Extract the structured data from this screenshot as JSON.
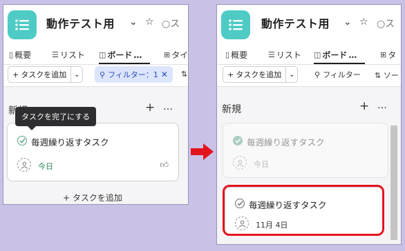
{
  "project": {
    "title": "動作テスト用",
    "star_icon": "star-icon",
    "status_fragment_left": "○ス",
    "status_fragment_right": "○ス"
  },
  "tabs": {
    "overview": "概要",
    "list": "リスト",
    "board": "ボード",
    "more": "…",
    "fragment_left": "タイ",
    "fragment_right": "タ"
  },
  "toolbar": {
    "add_task": "タスクを追加",
    "filter_active": "フィルター：1",
    "filter": "フィルター",
    "sort_right": "ソート"
  },
  "column": {
    "title": "新規",
    "plus": "+",
    "more": "…",
    "add_task_footer": "タスクを追加"
  },
  "left_card": {
    "tooltip": "タスクを完了にする",
    "name": "毎週繰り返すタスク",
    "due": "今日",
    "due_color": "#2e8a57"
  },
  "right_cards": [
    {
      "name": "毎週繰り返すタスク",
      "due": "今日",
      "completed": true
    },
    {
      "name": "毎週繰り返すタスク",
      "due": "11月 4日",
      "completed": false
    }
  ],
  "colors": {
    "background": "#c9c1e6",
    "app_icon": "#4ecbc4",
    "highlight": "#e3141d",
    "arrow": "#e3141d",
    "filter_active_bg": "#dce5fb"
  }
}
